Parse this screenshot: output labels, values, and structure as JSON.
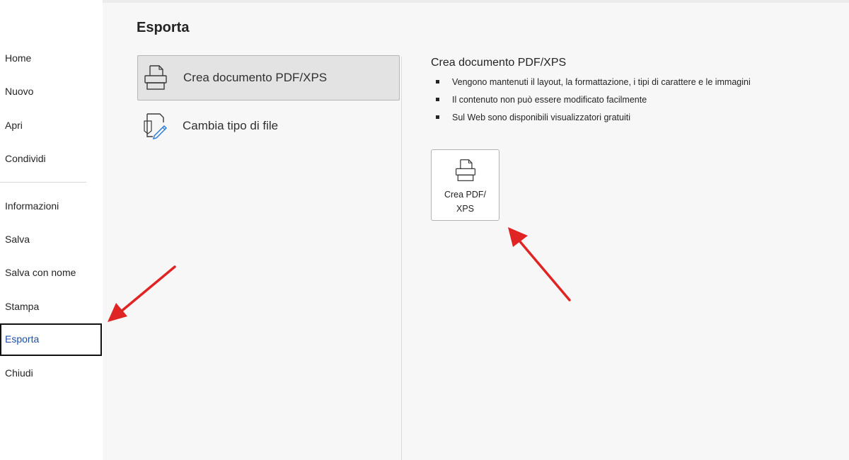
{
  "sidebar": {
    "items": [
      {
        "label": "Home"
      },
      {
        "label": "Nuovo"
      },
      {
        "label": "Apri"
      },
      {
        "label": "Condividi"
      },
      {
        "label": "Informazioni"
      },
      {
        "label": "Salva"
      },
      {
        "label": "Salva con nome"
      },
      {
        "label": "Stampa"
      },
      {
        "label": "Esporta",
        "active": true
      },
      {
        "label": "Chiudi"
      }
    ]
  },
  "main": {
    "title": "Esporta",
    "options": [
      {
        "label": "Crea documento PDF/XPS",
        "icon": "pdf-document-icon",
        "selected": true
      },
      {
        "label": "Cambia tipo di file",
        "icon": "change-file-type-icon",
        "selected": false
      }
    ],
    "detail": {
      "title": "Crea documento PDF/XPS",
      "bullets": [
        "Vengono mantenuti il layout, la formattazione, i tipi di carattere e le immagini",
        "Il contenuto non può essere modificato facilmente",
        "Sul Web sono disponibili visualizzatori gratuiti"
      ],
      "button": {
        "label": "Crea PDF/\nXPS",
        "icon": "pdf-document-icon"
      }
    }
  },
  "annotations": {
    "arrow_color": "#e02424"
  },
  "colors": {
    "active_nav_text": "#1e4fa8",
    "panel_background": "#f7f7f7"
  }
}
